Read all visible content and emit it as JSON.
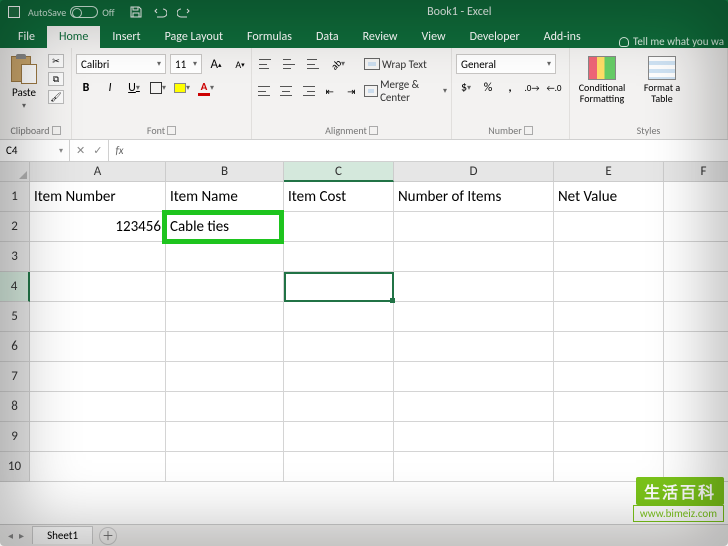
{
  "titlebar": {
    "autosave_label": "AutoSave",
    "autosave_state": "Off",
    "title": "Book1 - Excel"
  },
  "tabs": {
    "file": "File",
    "home": "Home",
    "insert": "Insert",
    "page_layout": "Page Layout",
    "formulas": "Formulas",
    "data": "Data",
    "review": "Review",
    "view": "View",
    "developer": "Developer",
    "addins": "Add-ins",
    "tell_me": "Tell me what you wa"
  },
  "ribbon": {
    "clipboard": {
      "paste": "Paste",
      "label": "Clipboard"
    },
    "font": {
      "name": "Calibri",
      "size": "11",
      "bold": "B",
      "italic": "I",
      "underline": "U",
      "grow": "A",
      "shrink": "A",
      "label": "Font"
    },
    "alignment": {
      "wrap": "Wrap Text",
      "merge": "Merge & Center",
      "label": "Alignment"
    },
    "number": {
      "format": "General",
      "label": "Number"
    },
    "styles": {
      "cond": "Conditional Formatting",
      "table": "Format a Table",
      "label": "Styles"
    }
  },
  "namebox": "C4",
  "formula": "",
  "columns": {
    "A": "A",
    "B": "B",
    "C": "C",
    "D": "D",
    "E": "E",
    "F": "F"
  },
  "rows": [
    "1",
    "2",
    "3",
    "4",
    "5",
    "6",
    "7",
    "8",
    "9",
    "10"
  ],
  "cells": {
    "A1": "Item Number",
    "B1": "Item Name",
    "C1": "Item Cost",
    "D1": "Number of Items",
    "E1": "Net Value",
    "A2": "123456",
    "B2": "Cable ties"
  },
  "sheets": {
    "s1": "Sheet1"
  },
  "watermark": {
    "ch": "生活百科",
    "url": "www.bimeiz.com"
  }
}
